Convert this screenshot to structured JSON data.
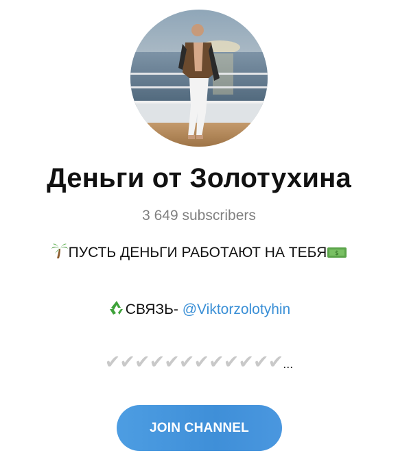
{
  "channel": {
    "title": "Деньги от Золотухина",
    "subscribers": "3 649 subscribers"
  },
  "description": {
    "line1_emoji": "palm-tree-icon",
    "line1_text": "ПУСТЬ ДЕНЬГИ РАБОТАЮТ НА ТЕБЯ",
    "line1_end_emoji": "money-bill-icon",
    "line2_emoji": "recycle-icon",
    "line2_prefix": "СВЯЗЬ- ",
    "line2_link": "@Viktorzolotyhin",
    "checkmarks": "✔✔✔✔✔✔✔✔✔✔✔✔",
    "ellipsis": "..."
  },
  "actions": {
    "join_label": "JOIN CHANNEL"
  },
  "colors": {
    "link": "#3a8fd6",
    "button": "#4a97df",
    "subtitle": "#808080"
  }
}
